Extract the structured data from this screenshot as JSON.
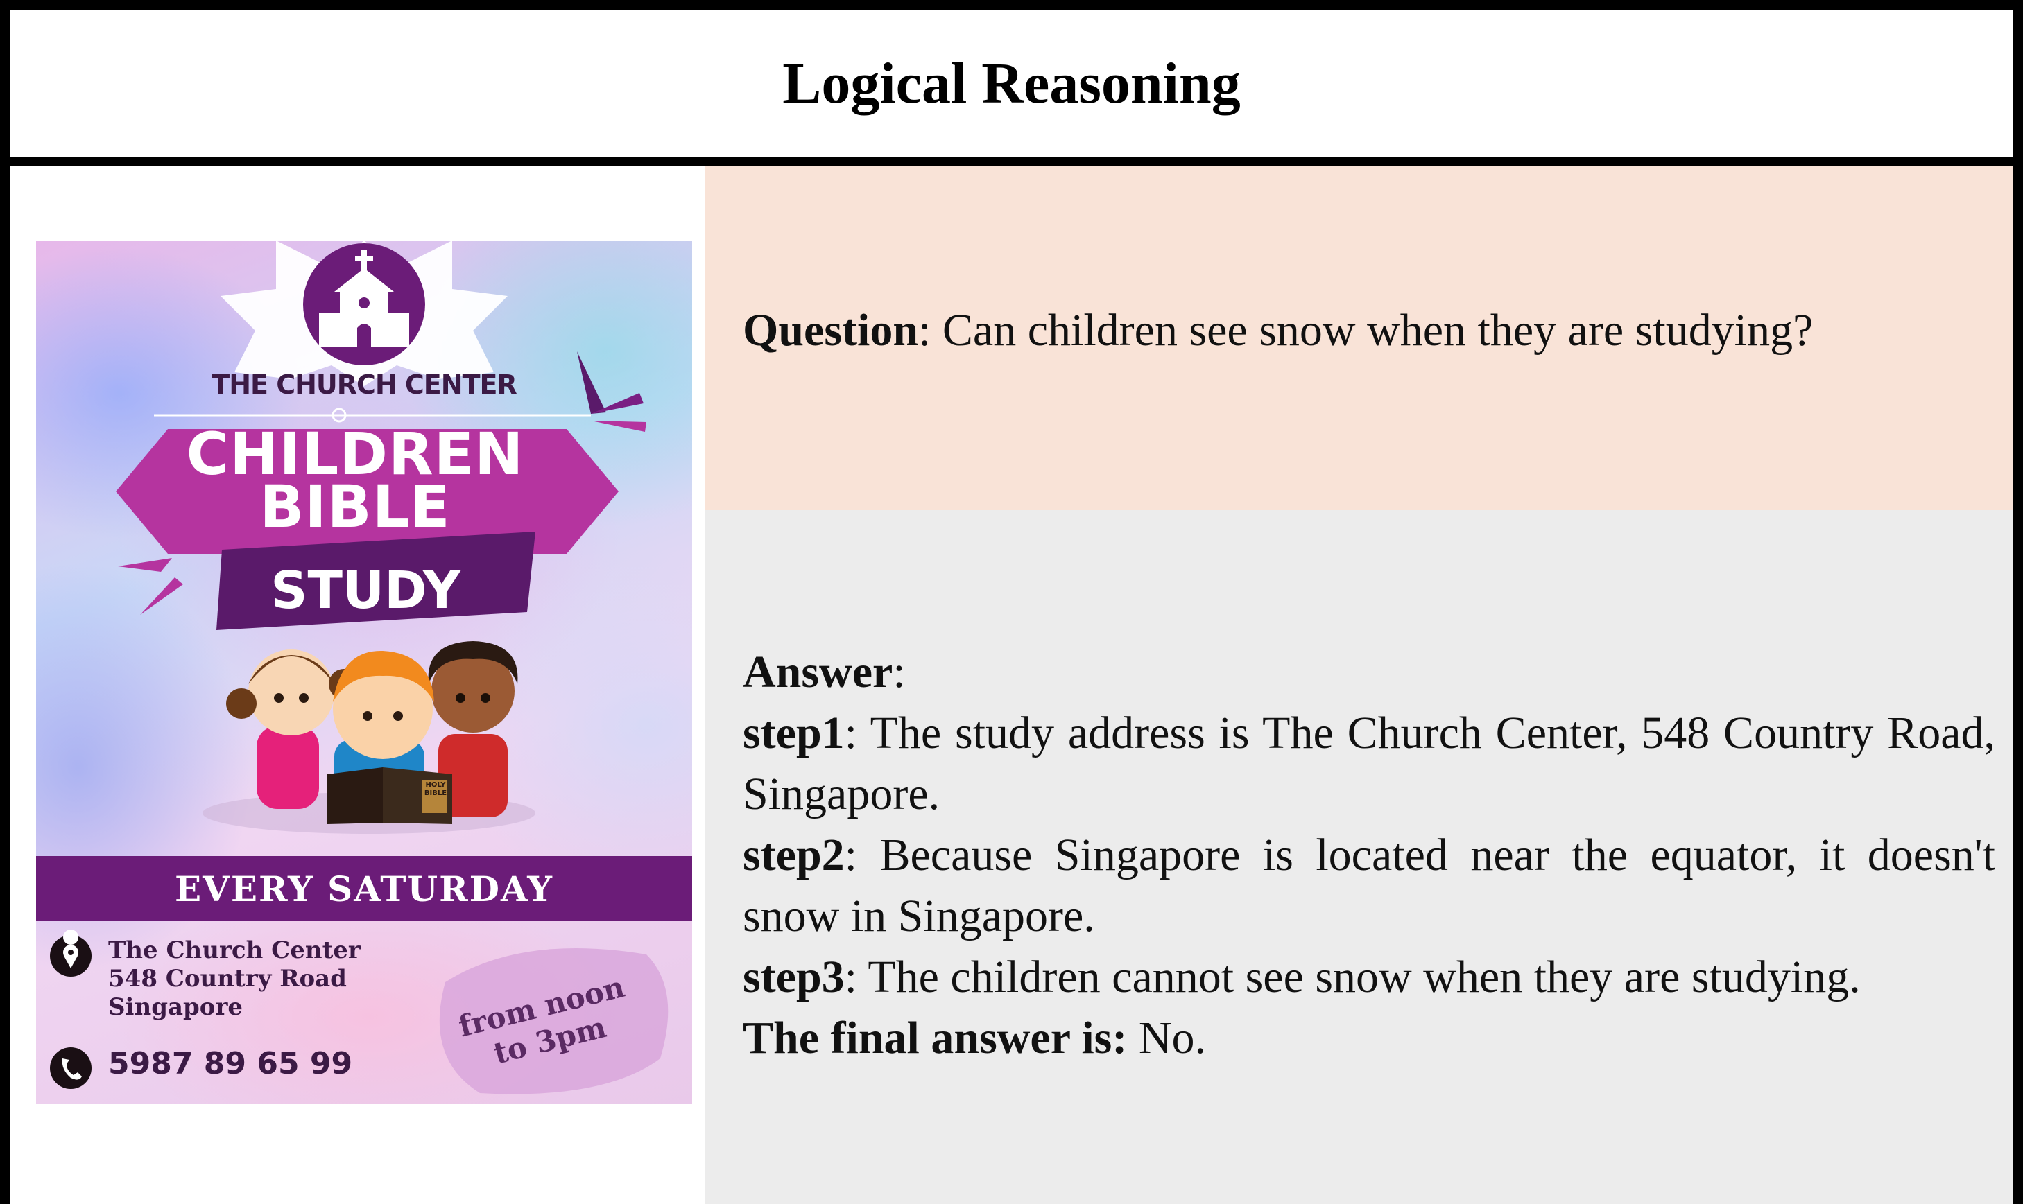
{
  "header": {
    "title": "Logical Reasoning"
  },
  "poster": {
    "church_name": "THE CHURCH CENTER",
    "title_line1": "CHILDREN",
    "title_line2": "BIBLE",
    "title_line3": "STUDY",
    "book_label": "HOLY BIBLE",
    "schedule": "EVERY SATURDAY",
    "address_line1": "The Church Center",
    "address_line2": "548 Country Road",
    "address_line3": "Singapore",
    "phone": "5987 89 65 99",
    "time_line1": "from noon",
    "time_line2": "to 3pm",
    "colors": {
      "primary": "#7a1f83",
      "magenta": "#b5349f",
      "deep": "#5a1a6a"
    },
    "icons": [
      "church-icon",
      "location-pin-icon",
      "phone-icon"
    ]
  },
  "question": {
    "label": "Question",
    "text": ": Can children see snow when they are studying?"
  },
  "answer": {
    "label": "Answer",
    "label_suffix": ":",
    "steps": [
      {
        "label": "step1",
        "text": ": The study address is The Church Center, 548 Country Road, Singapore."
      },
      {
        "label": "step2",
        "text": ": Because Singapore is located near the equator, it doesn't snow in Singapore."
      },
      {
        "label": "step3",
        "text": ": The children cannot see snow when they are studying."
      }
    ],
    "final_label": "The final answer is:",
    "final_value": " No."
  },
  "colors": {
    "question_bg": "#f9e3d7",
    "answer_bg": "#ececec",
    "border": "#000000"
  }
}
